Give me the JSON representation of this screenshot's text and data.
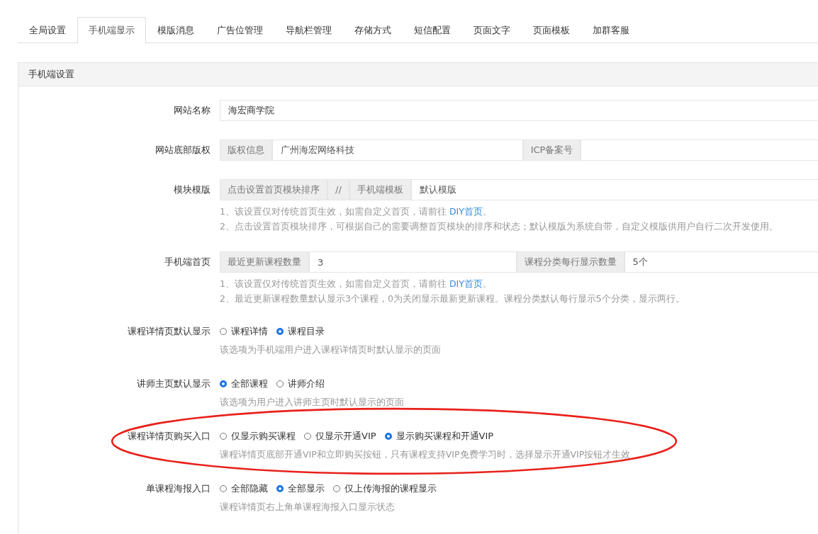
{
  "tabs": [
    {
      "label": "全局设置",
      "selected": false
    },
    {
      "label": "手机端显示",
      "selected": true
    },
    {
      "label": "模版消息",
      "selected": false
    },
    {
      "label": "广告位管理",
      "selected": false
    },
    {
      "label": "导航栏管理",
      "selected": false
    },
    {
      "label": "存储方式",
      "selected": false
    },
    {
      "label": "短信配置",
      "selected": false
    },
    {
      "label": "页面文字",
      "selected": false
    },
    {
      "label": "页面模板",
      "selected": false
    },
    {
      "label": "加群客服",
      "selected": false
    }
  ],
  "panel": {
    "title": "手机端设置",
    "rows": [
      {
        "kind": "group",
        "label": "网站名称",
        "parts": [
          {
            "kind": "input",
            "value": "海宏商学院"
          }
        ],
        "help": []
      },
      {
        "kind": "group",
        "label": "网站底部版权",
        "parts": [
          {
            "kind": "addon",
            "text": "版权信息"
          },
          {
            "kind": "input",
            "value": "广州海宏网络科技"
          },
          {
            "kind": "addon",
            "text": "ICP备案号"
          },
          {
            "kind": "input"
          }
        ],
        "help": []
      },
      {
        "kind": "group",
        "label": "模块模版",
        "parts": [
          {
            "kind": "addon",
            "text": "点击设置首页模块排序"
          },
          {
            "kind": "addon",
            "text": "//"
          },
          {
            "kind": "addon",
            "text": "手机端模板"
          },
          {
            "kind": "input",
            "value": "默认模版"
          }
        ],
        "help": [
          {
            "text": "1、该设置仅对传统首页生效，如需自定义首页，请前往 ",
            "link": "DIY首页",
            "after": "。"
          },
          {
            "text": "2、点击设置首页模块排序，可根据自己的需要调整首页模块的排序和状态；默认模版为系统自带，自定义模版供用户自行二次开发使用。"
          }
        ]
      },
      {
        "kind": "group",
        "label": "手机端首页",
        "parts": [
          {
            "kind": "addon",
            "text": "最近更新课程数量"
          },
          {
            "kind": "input",
            "value": "3"
          },
          {
            "kind": "addon",
            "text": "课程分类每行显示数量"
          },
          {
            "kind": "input",
            "value": "5个"
          }
        ],
        "help": [
          {
            "text": "1、该设置仅对传统首页生效，如需自定义首页，请前往 ",
            "link": "DIY首页",
            "after": "。"
          },
          {
            "text": "2、最近更新课程数量默认显示3个课程，0为关闭显示最新更新课程。课程分类默认每行显示5个分类，显示两行。"
          }
        ]
      },
      {
        "kind": "radio",
        "label": "课程详情页默认显示",
        "options": [
          {
            "label": "课程详情",
            "selected": false
          },
          {
            "label": "课程目录",
            "selected": true
          }
        ],
        "help": [
          {
            "text": "该选项为手机端用户进入课程详情页时默认显示的页面"
          }
        ]
      },
      {
        "kind": "radio",
        "label": "讲师主页默认显示",
        "options": [
          {
            "label": "全部课程",
            "selected": true
          },
          {
            "label": "讲师介绍",
            "selected": false
          }
        ],
        "help": [
          {
            "text": "该选项为用户进入讲师主页时默认显示的页面"
          }
        ]
      },
      {
        "kind": "radio",
        "label": "课程详情页购买入口",
        "circled": true,
        "options": [
          {
            "label": "仅显示购买课程",
            "selected": false
          },
          {
            "label": "仅显示开通VIP",
            "selected": false
          },
          {
            "label": "显示购买课程和开通VIP",
            "selected": true
          }
        ],
        "help": [
          {
            "text": "课程详情页底部开通VIP和立即购买按钮，只有课程支持VIP免费学习时，选择显示开通VIP按钮才生效"
          }
        ]
      },
      {
        "kind": "radio",
        "label": "单课程海报入口",
        "options": [
          {
            "label": "全部隐藏",
            "selected": false
          },
          {
            "label": "全部显示",
            "selected": true
          },
          {
            "label": "仅上传海报的课程显示",
            "selected": false
          }
        ],
        "help": [
          {
            "text": "课程详情页右上角单课程海报入口显示状态"
          }
        ]
      }
    ]
  }
}
